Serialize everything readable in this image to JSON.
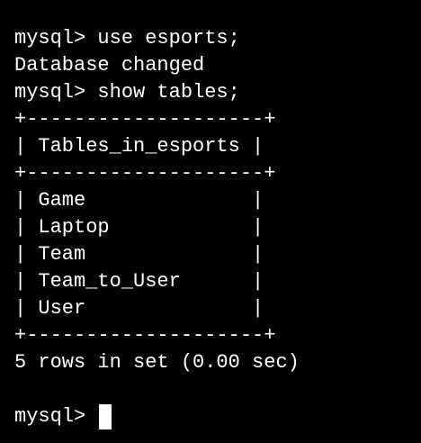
{
  "terminal": {
    "lines": [
      "mysql> use esports;",
      "Database changed",
      "mysql> show tables;",
      "+--------------------+",
      "| Tables_in_esports |",
      "+--------------------+",
      "| Game              |",
      "| Laptop            |",
      "| Team              |",
      "| Team_to_User      |",
      "| User              |",
      "+--------------------+",
      "5 rows in set (0.00 sec)",
      ""
    ],
    "current_prompt": "mysql> ",
    "colors": {
      "background": "#000000",
      "foreground": "#ffffff",
      "cursor": "#ffffff"
    }
  }
}
